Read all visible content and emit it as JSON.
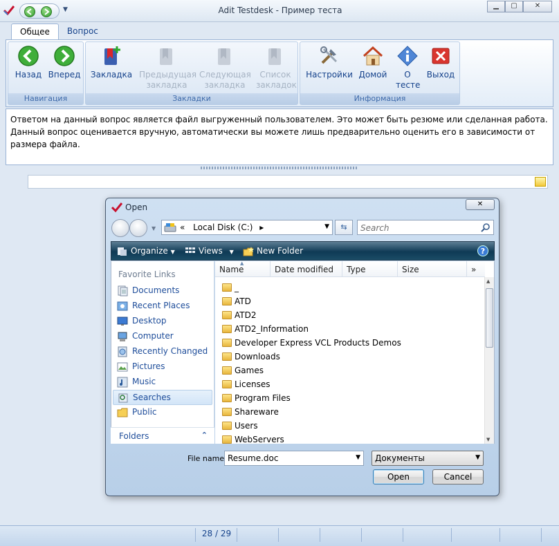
{
  "app": {
    "title": "Adit Testdesk - Пример теста",
    "icons": {
      "logo": "checkmark-logo-icon",
      "back": "back-arrow-icon",
      "forward": "forward-arrow-icon",
      "qat_menu": "chevron-down-icon"
    },
    "window_controls": {
      "minimize": "minimize-icon",
      "maximize": "maximize-icon",
      "close": "close-icon"
    }
  },
  "tabs": [
    {
      "label": "Общее",
      "active": true
    },
    {
      "label": "Вопрос",
      "active": false
    }
  ],
  "ribbon": {
    "groups": [
      {
        "label": "Навигация",
        "buttons": [
          {
            "label": "Назад",
            "icon": "green-back-arrow-icon",
            "enabled": true
          },
          {
            "label": "Вперед",
            "icon": "green-forward-arrow-icon",
            "enabled": true
          }
        ]
      },
      {
        "label": "Закладки",
        "buttons": [
          {
            "label": "Закладка",
            "icon": "add-bookmark-icon",
            "enabled": true
          },
          {
            "label": "Предыдущая закладка",
            "icon": "prev-bookmark-icon",
            "enabled": false
          },
          {
            "label": "Следующая закладка",
            "icon": "next-bookmark-icon",
            "enabled": false
          },
          {
            "label": "Список закладок",
            "icon": "bookmark-list-icon",
            "enabled": false
          }
        ]
      },
      {
        "label": "Информация",
        "buttons": [
          {
            "label": "Настройки",
            "icon": "tools-icon",
            "enabled": true
          },
          {
            "label": "Домой",
            "icon": "home-icon",
            "enabled": true
          },
          {
            "label": "О тесте",
            "icon": "info-icon",
            "enabled": true
          },
          {
            "label": "Выход",
            "icon": "exit-icon",
            "enabled": true
          }
        ]
      }
    ]
  },
  "question": {
    "text": "Ответом на данный вопрос является файл выгруженный пользователем. Это может быть резюме или сделанная работа. Данный вопрос оценивается вручную, автоматически вы можете лишь предварительно оценить его в зависимости от размера файла."
  },
  "answer": {
    "value": "",
    "browse_icon": "folder-icon"
  },
  "statusbar": {
    "page": "28 / 29"
  },
  "dialog": {
    "title": "Open",
    "close_icon": "close-icon",
    "address": {
      "prefix": "«",
      "path": "Local Disk (C:)",
      "separator": "▸"
    },
    "search_placeholder": "Search",
    "commands": {
      "organize": "Organize",
      "views": "Views",
      "new_folder": "New Folder",
      "help": "?"
    },
    "favorites_header": "Favorite Links",
    "favorites": [
      {
        "label": "Documents",
        "icon": "documents-icon",
        "selected": false
      },
      {
        "label": "Recent Places",
        "icon": "recent-places-icon",
        "selected": false
      },
      {
        "label": "Desktop",
        "icon": "desktop-icon",
        "selected": false
      },
      {
        "label": "Computer",
        "icon": "computer-icon",
        "selected": false
      },
      {
        "label": "Recently Changed",
        "icon": "recently-changed-icon",
        "selected": false
      },
      {
        "label": "Pictures",
        "icon": "pictures-icon",
        "selected": false
      },
      {
        "label": "Music",
        "icon": "music-icon",
        "selected": false
      },
      {
        "label": "Searches",
        "icon": "searches-icon",
        "selected": true
      },
      {
        "label": "Public",
        "icon": "public-folder-icon",
        "selected": false
      }
    ],
    "folders_label": "Folders",
    "columns": [
      "Name",
      "Date modified",
      "Type",
      "Size"
    ],
    "more_columns": "»",
    "files": [
      "_",
      "ATD",
      "ATD2",
      "ATD2_Information",
      "Developer Express VCL Products Demos",
      "Downloads",
      "Games",
      "Licenses",
      "Program Files",
      "Shareware",
      "Users",
      "WebServers"
    ],
    "file_name_label": "File name:",
    "file_name": "Resume.doc",
    "file_type": "Документы",
    "open_label": "Open",
    "cancel_label": "Cancel"
  }
}
